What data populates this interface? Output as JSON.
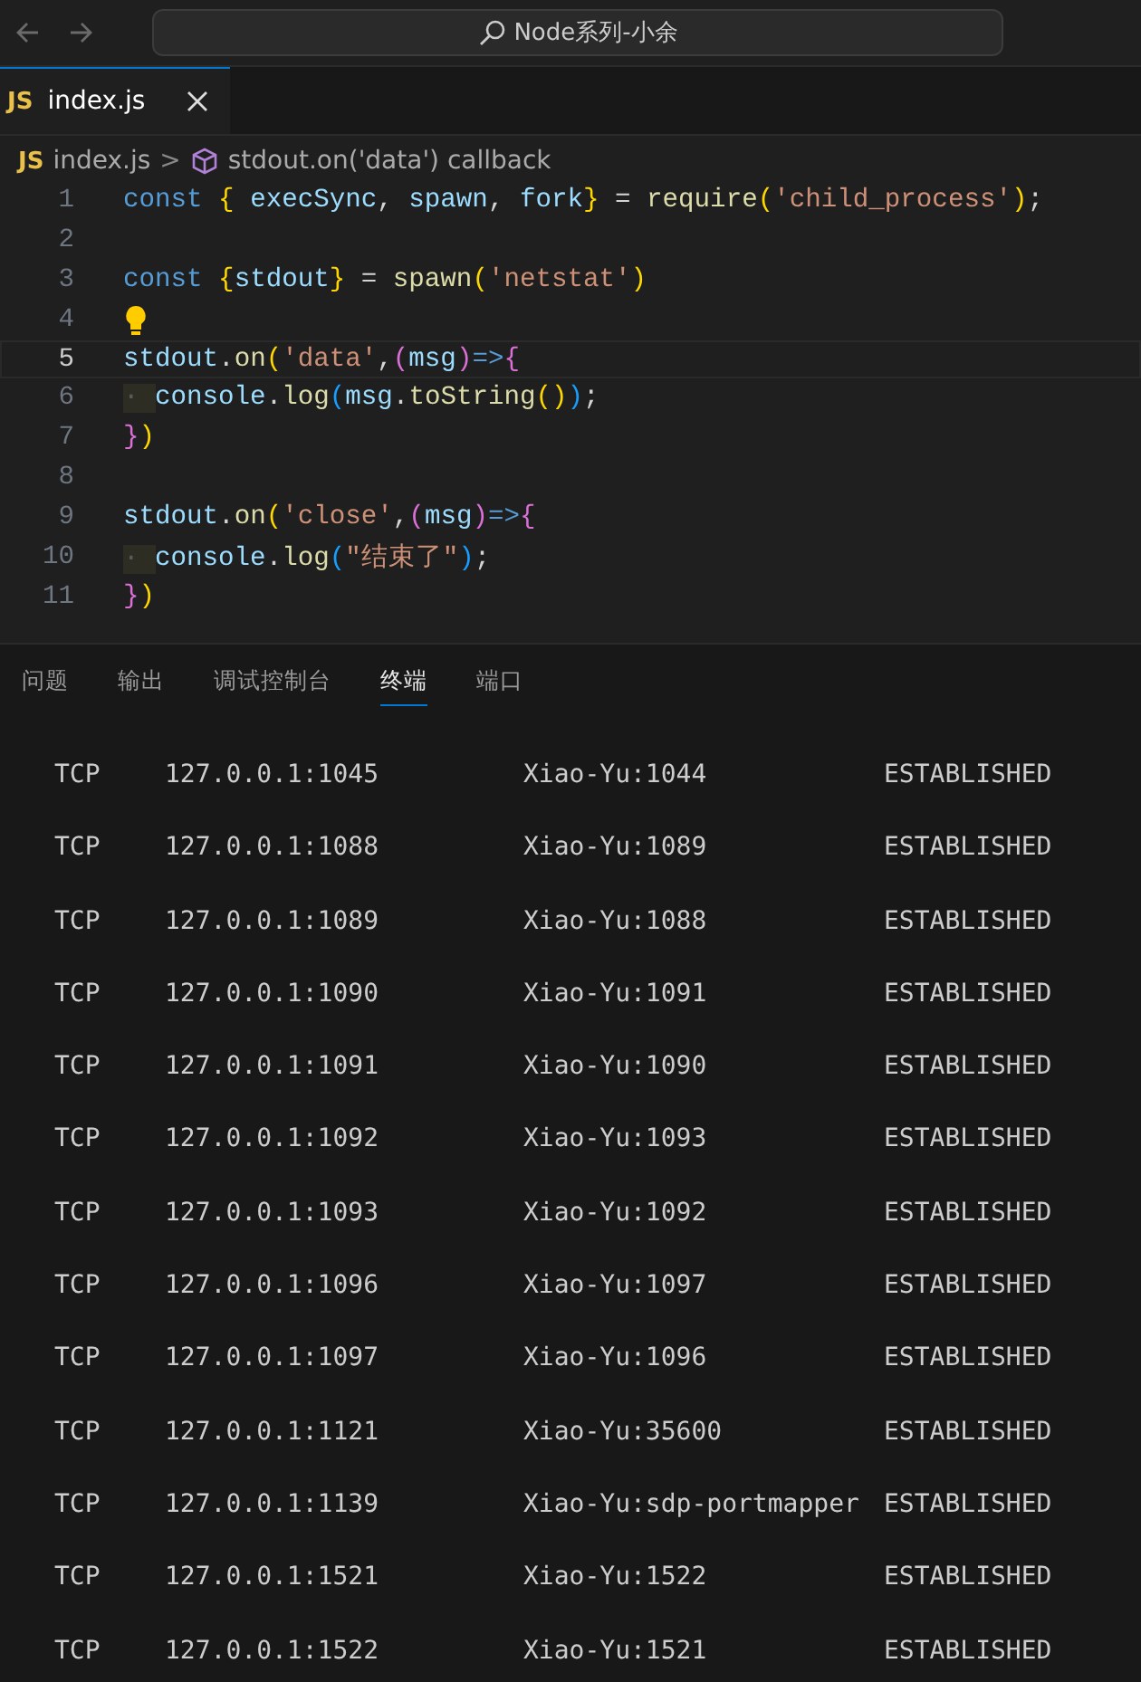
{
  "title_bar": {
    "search": "Node系列-小余"
  },
  "tabs": [
    {
      "label": "index.js",
      "icon": "JS",
      "selected": true
    }
  ],
  "breadcrumb": {
    "file_icon": "JS",
    "file": "index.js",
    "separator": ">",
    "symbol": "stdout.on('data') callback"
  },
  "code_lines": [
    {
      "number": "1",
      "current": false,
      "hint": false,
      "tokens": [
        {
          "kind": "keyword",
          "text": "const "
        },
        {
          "kind": "brace",
          "text": "{ "
        },
        {
          "kind": "var",
          "text": "execSync"
        },
        {
          "kind": "punct",
          "text": ", "
        },
        {
          "kind": "var",
          "text": "spawn"
        },
        {
          "kind": "punct",
          "text": ", "
        },
        {
          "kind": "var",
          "text": "fork"
        },
        {
          "kind": "brace",
          "text": "}"
        },
        {
          "kind": "punct",
          "text": " = "
        },
        {
          "kind": "func",
          "text": "require"
        },
        {
          "kind": "brace",
          "text": "("
        },
        {
          "kind": "string",
          "text": "'child_process'"
        },
        {
          "kind": "brace",
          "text": ")"
        },
        {
          "kind": "punct",
          "text": ";"
        }
      ]
    },
    {
      "number": "2",
      "current": false,
      "hint": false
    },
    {
      "number": "3",
      "current": false,
      "hint": false,
      "tokens": [
        {
          "kind": "keyword",
          "text": "const "
        },
        {
          "kind": "brace",
          "text": "{"
        },
        {
          "kind": "var",
          "text": "stdout"
        },
        {
          "kind": "brace",
          "text": "}"
        },
        {
          "kind": "punct",
          "text": " = "
        },
        {
          "kind": "func",
          "text": "spawn"
        },
        {
          "kind": "brace",
          "text": "("
        },
        {
          "kind": "string",
          "text": "'netstat'"
        },
        {
          "kind": "brace",
          "text": ")"
        }
      ]
    },
    {
      "number": "4",
      "current": false,
      "hint": true
    },
    {
      "number": "5",
      "current": true,
      "hint": false,
      "tokens": [
        {
          "kind": "var",
          "text": "stdout"
        },
        {
          "kind": "punct",
          "text": "."
        },
        {
          "kind": "func",
          "text": "on"
        },
        {
          "kind": "brace",
          "text": "("
        },
        {
          "kind": "string",
          "text": "'data'"
        },
        {
          "kind": "punct",
          "text": ","
        },
        {
          "kind": "paren2",
          "text": "("
        },
        {
          "kind": "var",
          "text": "msg"
        },
        {
          "kind": "paren2",
          "text": ")"
        },
        {
          "kind": "keyword",
          "text": "=>"
        },
        {
          "kind": "paren2",
          "text": "{"
        }
      ]
    },
    {
      "number": "6",
      "current": false,
      "hint": false,
      "tokens": [
        {
          "kind": "ws",
          "text": "· "
        },
        {
          "kind": "var",
          "text": "console"
        },
        {
          "kind": "punct",
          "text": "."
        },
        {
          "kind": "func",
          "text": "log"
        },
        {
          "kind": "paren3",
          "text": "("
        },
        {
          "kind": "var",
          "text": "msg"
        },
        {
          "kind": "punct",
          "text": "."
        },
        {
          "kind": "func",
          "text": "toString"
        },
        {
          "kind": "brace",
          "text": "()"
        },
        {
          "kind": "paren3",
          "text": ")"
        },
        {
          "kind": "punct",
          "text": ";"
        }
      ]
    },
    {
      "number": "7",
      "current": false,
      "hint": false,
      "tokens": [
        {
          "kind": "paren2",
          "text": "}"
        },
        {
          "kind": "brace",
          "text": ")"
        }
      ]
    },
    {
      "number": "8",
      "current": false,
      "hint": false
    },
    {
      "number": "9",
      "current": false,
      "hint": false,
      "tokens": [
        {
          "kind": "var",
          "text": "stdout"
        },
        {
          "kind": "punct",
          "text": "."
        },
        {
          "kind": "func",
          "text": "on"
        },
        {
          "kind": "brace",
          "text": "("
        },
        {
          "kind": "string",
          "text": "'close'"
        },
        {
          "kind": "punct",
          "text": ","
        },
        {
          "kind": "paren2",
          "text": "("
        },
        {
          "kind": "var",
          "text": "msg"
        },
        {
          "kind": "paren2",
          "text": ")"
        },
        {
          "kind": "keyword",
          "text": "=>"
        },
        {
          "kind": "paren2",
          "text": "{"
        }
      ]
    },
    {
      "number": "10",
      "current": false,
      "hint": false,
      "tokens": [
        {
          "kind": "ws",
          "text": "· "
        },
        {
          "kind": "var",
          "text": "console"
        },
        {
          "kind": "punct",
          "text": "."
        },
        {
          "kind": "func",
          "text": "log"
        },
        {
          "kind": "paren3",
          "text": "("
        },
        {
          "kind": "string",
          "text": "\"结束了\""
        },
        {
          "kind": "paren3",
          "text": ")"
        },
        {
          "kind": "punct",
          "text": ";"
        }
      ]
    },
    {
      "number": "11",
      "current": false,
      "hint": false,
      "tokens": [
        {
          "kind": "paren2",
          "text": "}"
        },
        {
          "kind": "brace",
          "text": ")"
        }
      ]
    }
  ],
  "panel_tabs": [
    {
      "label": "问题",
      "selected": false
    },
    {
      "label": "输出",
      "selected": false
    },
    {
      "label": "调试控制台",
      "selected": false
    },
    {
      "label": "终端",
      "selected": true
    },
    {
      "label": "端口",
      "selected": false
    }
  ],
  "terminal_rows": [
    {
      "protocol": "TCP",
      "local": "127.0.0.1:1045",
      "foreign": "Xiao-Yu:1044",
      "state": "ESTABLISHED"
    },
    {
      "protocol": "TCP",
      "local": "127.0.0.1:1088",
      "foreign": "Xiao-Yu:1089",
      "state": "ESTABLISHED"
    },
    {
      "protocol": "TCP",
      "local": "127.0.0.1:1089",
      "foreign": "Xiao-Yu:1088",
      "state": "ESTABLISHED"
    },
    {
      "protocol": "TCP",
      "local": "127.0.0.1:1090",
      "foreign": "Xiao-Yu:1091",
      "state": "ESTABLISHED"
    },
    {
      "protocol": "TCP",
      "local": "127.0.0.1:1091",
      "foreign": "Xiao-Yu:1090",
      "state": "ESTABLISHED"
    },
    {
      "protocol": "TCP",
      "local": "127.0.0.1:1092",
      "foreign": "Xiao-Yu:1093",
      "state": "ESTABLISHED"
    },
    {
      "protocol": "TCP",
      "local": "127.0.0.1:1093",
      "foreign": "Xiao-Yu:1092",
      "state": "ESTABLISHED"
    },
    {
      "protocol": "TCP",
      "local": "127.0.0.1:1096",
      "foreign": "Xiao-Yu:1097",
      "state": "ESTABLISHED"
    },
    {
      "protocol": "TCP",
      "local": "127.0.0.1:1097",
      "foreign": "Xiao-Yu:1096",
      "state": "ESTABLISHED"
    },
    {
      "protocol": "TCP",
      "local": "127.0.0.1:1121",
      "foreign": "Xiao-Yu:35600",
      "state": "ESTABLISHED"
    },
    {
      "protocol": "TCP",
      "local": "127.0.0.1:1139",
      "foreign": "Xiao-Yu:sdp-portmapper",
      "state": "ESTABLISHED"
    },
    {
      "protocol": "TCP",
      "local": "127.0.0.1:1521",
      "foreign": "Xiao-Yu:1522",
      "state": "ESTABLISHED"
    },
    {
      "protocol": "TCP",
      "local": "127.0.0.1:1522",
      "foreign": "Xiao-Yu:1521",
      "state": "ESTABLISHED"
    }
  ]
}
